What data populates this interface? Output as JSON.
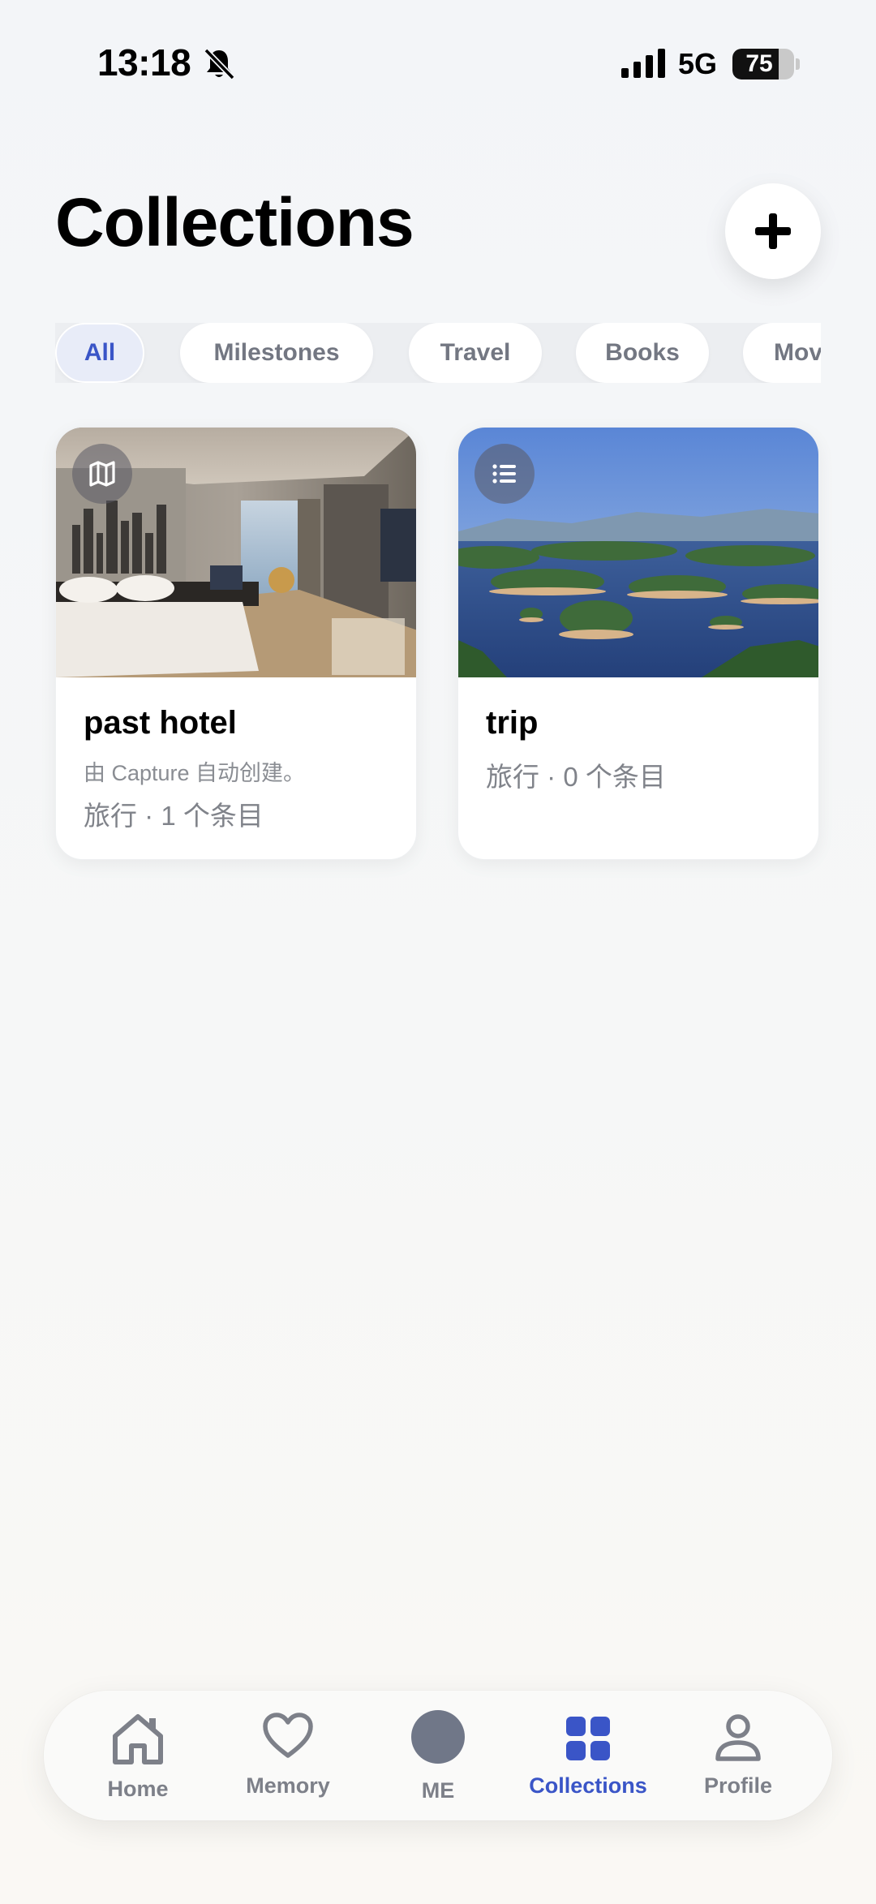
{
  "status_bar": {
    "time": "13:18",
    "network": "5G",
    "battery": "75",
    "battery_level": 0.75
  },
  "header": {
    "title": "Collections",
    "add_icon": "plus-icon"
  },
  "filters": {
    "items": [
      "All",
      "Milestones",
      "Travel",
      "Books",
      "Movies"
    ],
    "selected": "All"
  },
  "collections": [
    {
      "title": "past hotel",
      "description": "由 Capture 自动创建。",
      "meta": "旅行 · 1 个条目",
      "badge_icon": "map-icon",
      "image": "hotel room photo"
    },
    {
      "title": "trip",
      "description": "",
      "meta": "旅行 · 0 个条目",
      "badge_icon": "list-icon",
      "image": "lake with islands photo"
    }
  ],
  "bottom_nav": {
    "items": [
      {
        "label": "Home",
        "icon": "home-icon"
      },
      {
        "label": "Memory",
        "icon": "heart-icon"
      },
      {
        "label": "ME",
        "icon": "avatar"
      },
      {
        "label": "Collections",
        "icon": "grid-icon"
      },
      {
        "label": "Profile",
        "icon": "person-icon"
      }
    ],
    "active": "Collections"
  },
  "colors": {
    "accent": "#3a55c7",
    "muted": "#7d8089",
    "background": "#f4f6f8"
  }
}
